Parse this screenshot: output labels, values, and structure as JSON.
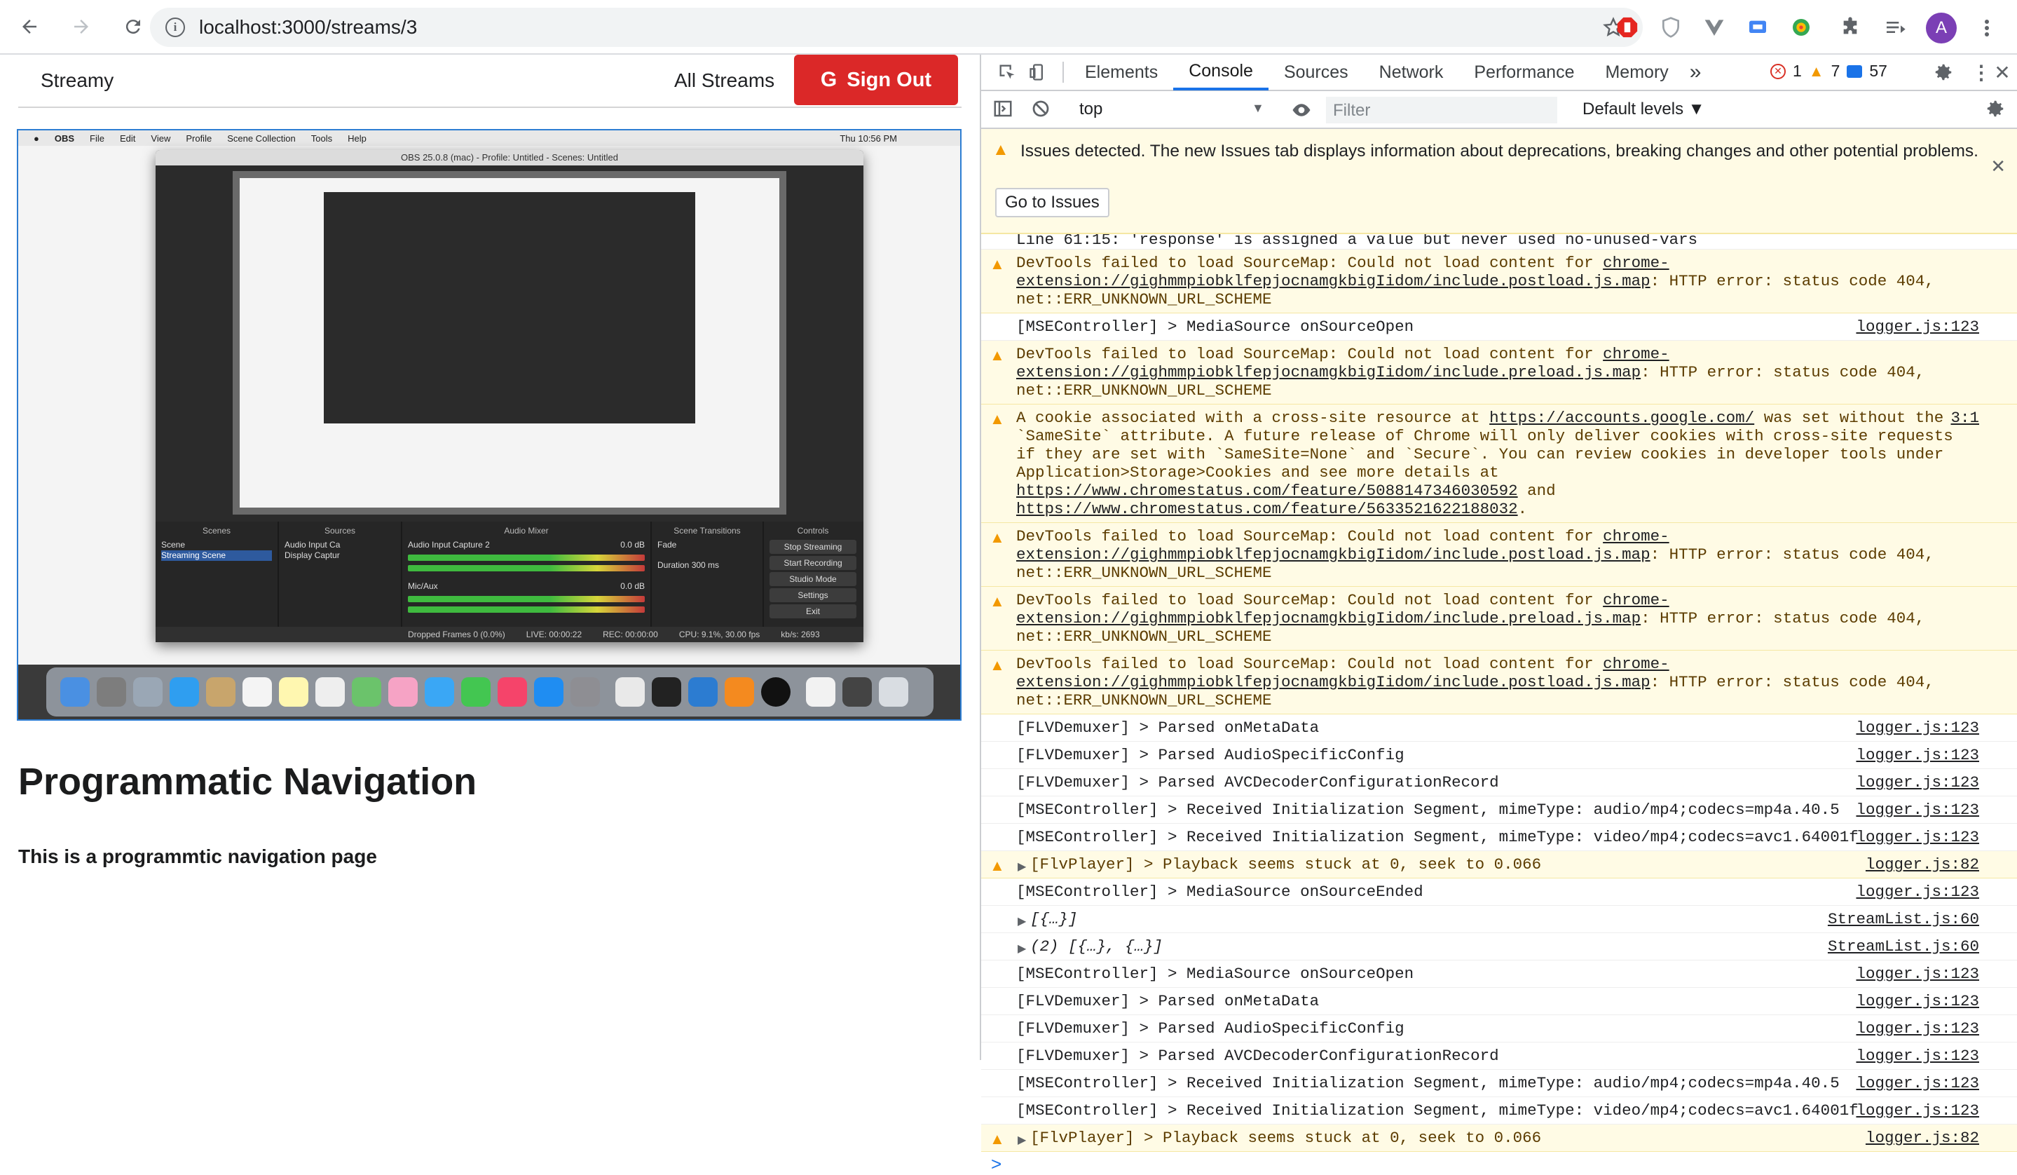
{
  "browser": {
    "url": "localhost:3000/streams/3",
    "profile_initial": "A"
  },
  "app": {
    "brand": "Streamy",
    "all_streams": "All Streams",
    "sign_out": "Sign Out",
    "sign_out_icon": "G"
  },
  "video": {
    "mac_menu": [
      "OBS",
      "File",
      "Edit",
      "View",
      "Profile",
      "Scene Collection",
      "Tools",
      "Help"
    ],
    "clock": "Thu 10:56 PM",
    "obs_title": "OBS 25.0.8 (mac) - Profile: Untitled - Scenes: Untitled",
    "docks": {
      "scenes_title": "Scenes",
      "scenes": [
        "Scene",
        "Streaming Scene"
      ],
      "sources_title": "Sources",
      "sources": [
        "Audio Input Ca",
        "Display Captur"
      ],
      "mixer_title": "Audio Mixer",
      "mixer": [
        {
          "name": "Audio Input Capture 2",
          "db": "0.0 dB"
        },
        {
          "name": "Mic/Aux",
          "db": "0.0 dB"
        }
      ],
      "transitions_title": "Scene Transitions",
      "transition": "Fade",
      "duration_label": "Duration",
      "duration": "300 ms",
      "controls_title": "Controls",
      "controls": [
        "Stop Streaming",
        "Start Recording",
        "Studio Mode",
        "Settings",
        "Exit"
      ]
    },
    "status": {
      "dropped": "Dropped Frames 0 (0.0%)",
      "live": "LIVE: 00:00:22",
      "rec": "REC: 00:00:00",
      "cpu": "CPU: 9.1%, 30.00 fps",
      "kbps": "kb/s: 2693"
    }
  },
  "content": {
    "heading": "Programmatic Navigation",
    "subtext": "This is a programmtic navigation page"
  },
  "devtools": {
    "tabs": [
      "Elements",
      "Console",
      "Sources",
      "Network",
      "Performance",
      "Memory"
    ],
    "active_tab": "Console",
    "more": "»",
    "counts": {
      "errors": "1",
      "warnings": "7",
      "info": "57"
    },
    "context": "top",
    "filter_placeholder": "Filter",
    "levels": "Default levels ▼",
    "issues_message": "Issues detected. The new Issues tab displays information about deprecations, breaking changes and other potential problems.",
    "go_to_issues": "Go to Issues",
    "messages": [
      {
        "type": "info",
        "partial": true,
        "text": "  Line 61:15:  'response' is assigned a value but never used  no-unused-vars",
        "src": ""
      },
      {
        "type": "warning",
        "text_a": "DevTools failed to load SourceMap: Could not load content for ",
        "link": "chrome-extension://gighmmpiobklfepjocnamgkbigIidom/include.postload.js.map",
        "text_b": ": HTTP error: status code 404, net::ERR_UNKNOWN_URL_SCHEME",
        "src": ""
      },
      {
        "type": "info",
        "text": "[MSEController] > MediaSource onSourceOpen",
        "src": "logger.js:123"
      },
      {
        "type": "warning",
        "text_a": "DevTools failed to load SourceMap: Could not load content for ",
        "link": "chrome-extension://gighmmpiobklfepjocnamgkbigIidom/include.preload.js.map",
        "text_b": ": HTTP error: status code 404, net::ERR_UNKNOWN_URL_SCHEME",
        "src": ""
      },
      {
        "type": "warning",
        "text_a": "A cookie associated with a cross-site resource at ",
        "link": "https://accounts.google.com/",
        "text_b": " was set without the `SameSite` attribute. A future release of Chrome will only deliver cookies with cross-site requests if they are set with `SameSite=None` and `Secure`. You can review cookies in developer tools under Application>Storage>Cookies and see more details at ",
        "link2": "https://www.chromestatus.com/feature/5088147346030592",
        "text_c": " and ",
        "link3": "https://www.chromestatus.com/feature/5633521622188032",
        "text_d": ".",
        "src": "3:1"
      },
      {
        "type": "warning",
        "text_a": "DevTools failed to load SourceMap: Could not load content for ",
        "link": "chrome-extension://gighmmpiobklfepjocnamgkbigIidom/include.postload.js.map",
        "text_b": ": HTTP error: status code 404, net::ERR_UNKNOWN_URL_SCHEME",
        "src": ""
      },
      {
        "type": "warning",
        "text_a": "DevTools failed to load SourceMap: Could not load content for ",
        "link": "chrome-extension://gighmmpiobklfepjocnamgkbigIidom/include.preload.js.map",
        "text_b": ": HTTP error: status code 404, net::ERR_UNKNOWN_URL_SCHEME",
        "src": ""
      },
      {
        "type": "warning",
        "text_a": "DevTools failed to load SourceMap: Could not load content for ",
        "link": "chrome-extension://gighmmpiobklfepjocnamgkbigIidom/include.postload.js.map",
        "text_b": ": HTTP error: status code 404, net::ERR_UNKNOWN_URL_SCHEME",
        "src": ""
      },
      {
        "type": "info",
        "text": "[FLVDemuxer] > Parsed onMetaData",
        "src": "logger.js:123"
      },
      {
        "type": "info",
        "text": "[FLVDemuxer] > Parsed AudioSpecificConfig",
        "src": "logger.js:123"
      },
      {
        "type": "info",
        "text": "[FLVDemuxer] > Parsed AVCDecoderConfigurationRecord",
        "src": "logger.js:123"
      },
      {
        "type": "info",
        "text": "[MSEController] > Received Initialization Segment, mimeType: audio/mp4;codecs=mp4a.40.5",
        "src": "logger.js:123"
      },
      {
        "type": "info",
        "text": "[MSEController] > Received Initialization Segment, mimeType: video/mp4;codecs=avc1.64001f",
        "src": "logger.js:123"
      },
      {
        "type": "warning",
        "caret": true,
        "text": "[FlvPlayer] > Playback seems stuck at 0, seek to 0.066",
        "src": "logger.js:82"
      },
      {
        "type": "info",
        "text": "[MSEController] > MediaSource onSourceEnded",
        "src": "logger.js:123"
      },
      {
        "type": "info",
        "caret": true,
        "obj": true,
        "text": "[{…}]",
        "src": "StreamList.js:60"
      },
      {
        "type": "info",
        "caret": true,
        "obj": true,
        "text": "(2) [{…}, {…}]",
        "src": "StreamList.js:60"
      },
      {
        "type": "info",
        "text": "[MSEController] > MediaSource onSourceOpen",
        "src": "logger.js:123"
      },
      {
        "type": "info",
        "text": "[FLVDemuxer] > Parsed onMetaData",
        "src": "logger.js:123"
      },
      {
        "type": "info",
        "text": "[FLVDemuxer] > Parsed AudioSpecificConfig",
        "src": "logger.js:123"
      },
      {
        "type": "info",
        "text": "[FLVDemuxer] > Parsed AVCDecoderConfigurationRecord",
        "src": "logger.js:123"
      },
      {
        "type": "info",
        "text": "[MSEController] > Received Initialization Segment, mimeType: audio/mp4;codecs=mp4a.40.5",
        "src": "logger.js:123"
      },
      {
        "type": "info",
        "text": "[MSEController] > Received Initialization Segment, mimeType: video/mp4;codecs=avc1.64001f",
        "src": "logger.js:123"
      },
      {
        "type": "warning",
        "caret": true,
        "text": "[FlvPlayer] > Playback seems stuck at 0, seek to 0.066",
        "src": "logger.js:82"
      }
    ],
    "prompt": ">"
  },
  "colors": {
    "sign_out_bg": "#db2828",
    "tab_active": "#1a73e8",
    "warning_bg": "#fffbe5",
    "video_border": "#2d7dd2"
  }
}
